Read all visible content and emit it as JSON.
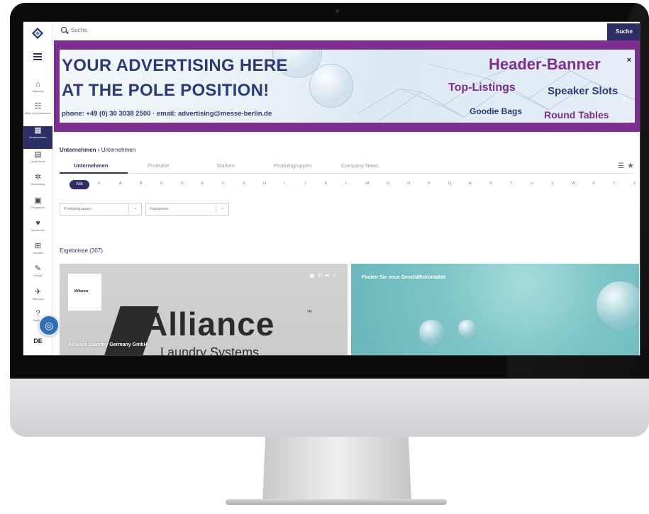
{
  "search": {
    "placeholder": "Suche",
    "button": "Suche"
  },
  "sidebar": {
    "items": [
      {
        "label": "Startseite",
        "icon": "home-icon"
      },
      {
        "label": "Main Terminkalender",
        "icon": "calendar-list-icon"
      },
      {
        "label": "Unternehmen",
        "icon": "company-icon",
        "active": true
      },
      {
        "label": "Lead Finder",
        "icon": "briefcase-icon"
      },
      {
        "label": "Networking",
        "icon": "network-icon"
      },
      {
        "label": "Programm",
        "icon": "program-icon"
      },
      {
        "label": "Sponsoren",
        "icon": "heart-icon"
      },
      {
        "label": "Goodies",
        "icon": "gift-icon"
      },
      {
        "label": "Presse",
        "icon": "microphone-icon"
      },
      {
        "label": "Start-ups",
        "icon": "rocket-icon"
      },
      {
        "label": "Support",
        "icon": "help-icon"
      }
    ],
    "language": "DE"
  },
  "banner": {
    "line1": "YOUR ADVERTISING HERE",
    "line2": "AT THE POLE POSITION!",
    "contact": "phone: +49 (0) 30 3038 2500 · email: advertising@messe-berlin.de",
    "header": "Header-Banner",
    "top_listings": "Top-Listings",
    "speaker_slots": "Speaker Slots",
    "goodie_bags": "Goodie Bags",
    "round_tables": "Round Tables",
    "close": "×",
    "colors": {
      "frame": "#7d2f91",
      "primary": "#2b3a78"
    }
  },
  "breadcrumb": {
    "root": "Unternehmen",
    "separator": "›",
    "current": "Unternehmen"
  },
  "tabs": [
    "Unternehmen",
    "Produkte",
    "Marken",
    "Produktgruppen",
    "Company News"
  ],
  "alphabet": {
    "all": "Alle",
    "letters": [
      "#",
      "A",
      "B",
      "C",
      "D",
      "E",
      "F",
      "G",
      "H",
      "I",
      "J",
      "K",
      "L",
      "M",
      "N",
      "O",
      "P",
      "Q",
      "R",
      "S",
      "T",
      "U",
      "V",
      "W",
      "X",
      "Y",
      "Z"
    ]
  },
  "filters": [
    "Produktgruppen",
    "Kategorien"
  ],
  "results": "Ergebnisse (307)",
  "cards": [
    {
      "name": "Alliance Laundry Germany GmbH",
      "logo_small": "/Alliance",
      "logo_word": "Alliance",
      "logo_tm": "™",
      "logo_sub": "Laundry Systems"
    },
    {
      "title": "Finden Sie neue Geschäftskontakte"
    }
  ],
  "colors": {
    "accent": "#2b2f66",
    "fingerprint": "#2e6fb5"
  }
}
